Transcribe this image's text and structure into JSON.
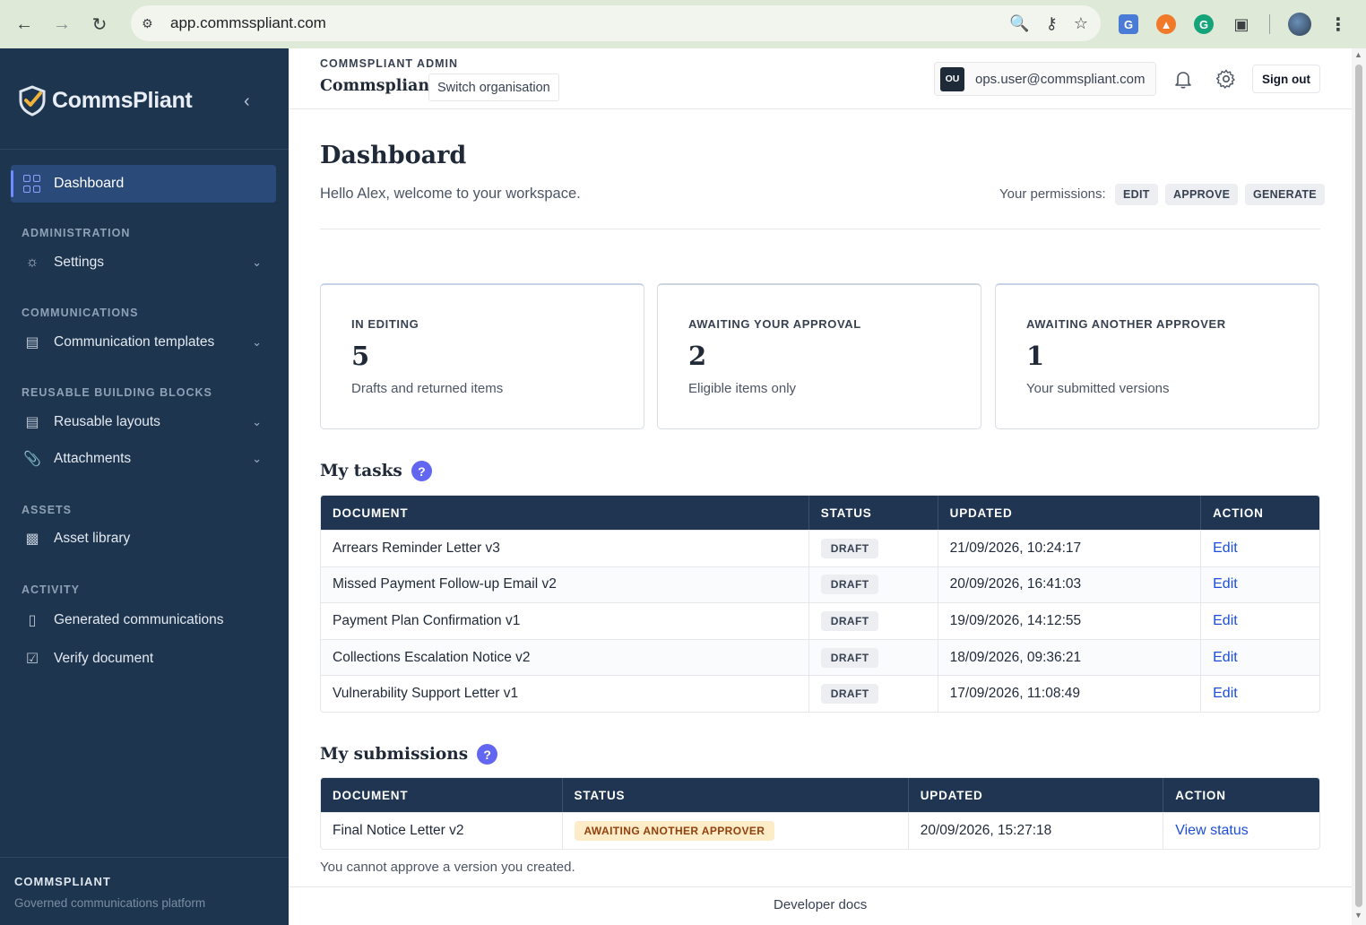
{
  "browser": {
    "url": "app.commsspliant.com"
  },
  "sidebar": {
    "brand": "CommsPliant",
    "active_item": "Dashboard",
    "sections": [
      {
        "title": "ADMINISTRATION",
        "items": [
          {
            "label": "Settings",
            "icon": "sun-gear-icon",
            "expandable": true
          }
        ]
      },
      {
        "title": "COMMUNICATIONS",
        "items": [
          {
            "label": "Communication templates",
            "icon": "document-icon",
            "expandable": true
          }
        ]
      },
      {
        "title": "REUSABLE BUILDING BLOCKS",
        "items": [
          {
            "label": "Reusable layouts",
            "icon": "document-icon",
            "expandable": true
          },
          {
            "label": "Attachments",
            "icon": "paperclip-icon",
            "expandable": true
          }
        ]
      },
      {
        "title": "ASSETS",
        "items": [
          {
            "label": "Asset library",
            "icon": "image-icon",
            "expandable": false
          }
        ]
      },
      {
        "title": "ACTIVITY",
        "items": [
          {
            "label": "Generated communications",
            "icon": "device-icon",
            "expandable": false
          },
          {
            "label": "Verify document",
            "icon": "check-document-icon",
            "expandable": false
          }
        ]
      }
    ],
    "footer_title": "COMMSPLIANT",
    "footer_subtitle": "Governed communications platform"
  },
  "topbar": {
    "kicker": "COMMSPLIANT ADMIN",
    "org_name": "Commspliant",
    "switch_org": "Switch organisation",
    "user_initials": "OU",
    "user_email": "ops.user@commspliant.com",
    "sign_out": "Sign out"
  },
  "dashboard": {
    "title": "Dashboard",
    "welcome": "Hello Alex, welcome to your workspace.",
    "permissions_label": "Your permissions:",
    "permissions": [
      "EDIT",
      "APPROVE",
      "GENERATE"
    ]
  },
  "stats": [
    {
      "label": "IN EDITING",
      "value": "5",
      "sub": "Drafts and returned items"
    },
    {
      "label": "AWAITING YOUR APPROVAL",
      "value": "2",
      "sub": "Eligible items only"
    },
    {
      "label": "AWAITING ANOTHER APPROVER",
      "value": "1",
      "sub": "Your submitted versions"
    }
  ],
  "tasks": {
    "title": "My tasks",
    "help": "?",
    "columns": [
      "DOCUMENT",
      "STATUS",
      "UPDATED",
      "ACTION"
    ],
    "rows": [
      {
        "document": "Arrears Reminder Letter v3",
        "status": "DRAFT",
        "updated": "21/09/2026, 10:24:17",
        "action": "Edit"
      },
      {
        "document": "Missed Payment Follow-up Email v2",
        "status": "DRAFT",
        "updated": "20/09/2026, 16:41:03",
        "action": "Edit"
      },
      {
        "document": "Payment Plan Confirmation v1",
        "status": "DRAFT",
        "updated": "19/09/2026, 14:12:55",
        "action": "Edit"
      },
      {
        "document": "Collections Escalation Notice v2",
        "status": "DRAFT",
        "updated": "18/09/2026, 09:36:21",
        "action": "Edit"
      },
      {
        "document": "Vulnerability Support Letter v1",
        "status": "DRAFT",
        "updated": "17/09/2026, 11:08:49",
        "action": "Edit"
      }
    ]
  },
  "submissions": {
    "title": "My submissions",
    "help": "?",
    "columns": [
      "DOCUMENT",
      "STATUS",
      "UPDATED",
      "ACTION"
    ],
    "rows": [
      {
        "document": "Final Notice Letter v2",
        "status": "AWAITING ANOTHER APPROVER",
        "updated": "20/09/2026, 15:27:18",
        "action": "View status"
      }
    ],
    "note": "You cannot approve a version you created."
  },
  "footer": {
    "developer_docs": "Developer docs"
  },
  "colors": {
    "sidebar_bg": "#1e3550",
    "active_nav": "#2a4a7a",
    "table_header": "#1f3551",
    "link": "#1d4ed8",
    "help_badge": "#6366f1",
    "amber_badge": "#fdecc8"
  }
}
